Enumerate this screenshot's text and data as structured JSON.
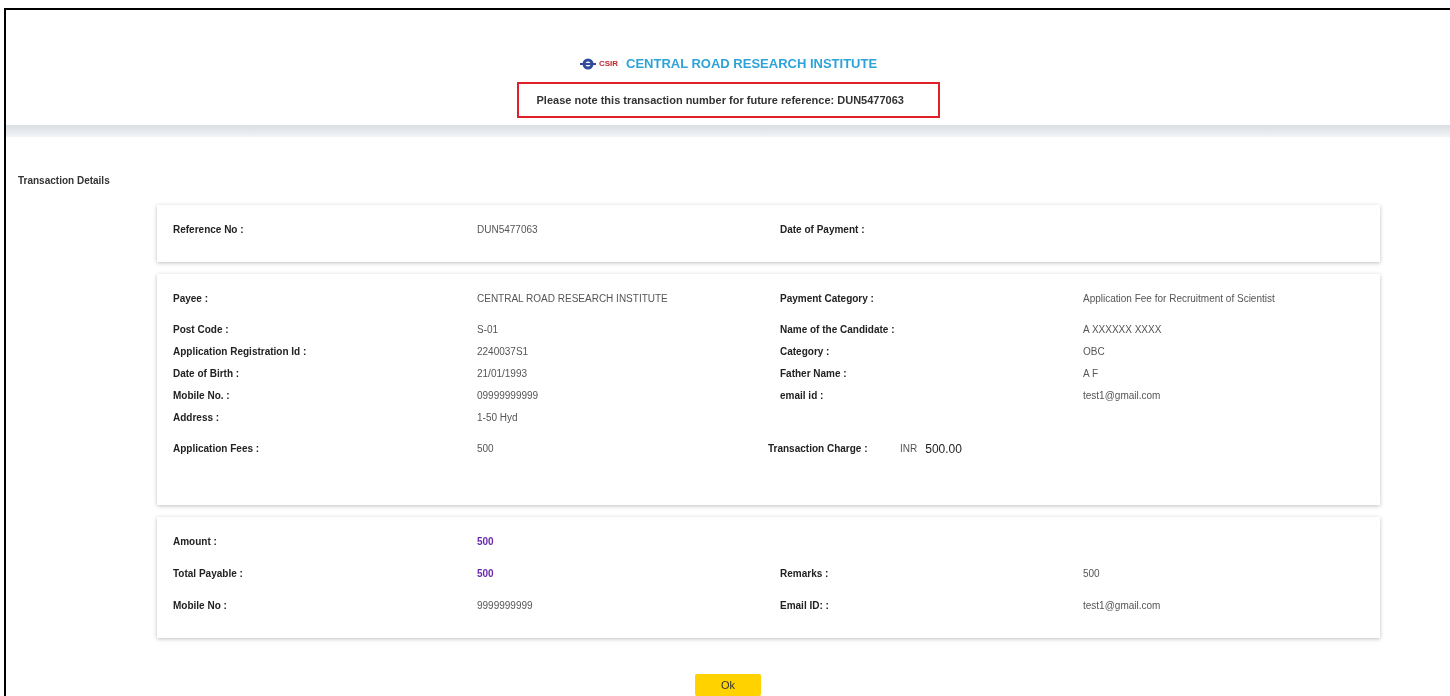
{
  "header": {
    "logo_text": "CSIR",
    "title": "CENTRAL ROAD RESEARCH INSTITUTE",
    "notice": "Please note this transaction number for future reference: DUN5477063"
  },
  "section_title": "Transaction Details",
  "cards": [
    {
      "rows": [
        {
          "left": {
            "label": "Reference No :",
            "value": "DUN5477063"
          },
          "right": {
            "label": "Date of Payment :"
          }
        }
      ]
    },
    {
      "rows": [
        {
          "left": {
            "label": "Payee :",
            "value": "CENTRAL ROAD RESEARCH INSTITUTE"
          },
          "right": {
            "label": "Payment Category :",
            "value": "Application Fee for Recruitment of Scientist"
          }
        },
        {
          "left": {
            "label": "Post Code :",
            "value": "S-01"
          },
          "right": {
            "label": "Name of the Candidate :",
            "value": "A XXXXXX XXXX"
          }
        },
        {
          "left": {
            "label": "Application Registration Id :",
            "value": "2240037S1"
          },
          "right": {
            "label": "Category :",
            "value": "OBC"
          }
        },
        {
          "left": {
            "label": "Date of Birth :",
            "value": "21/01/1993"
          },
          "right": {
            "label": "Father Name :",
            "value": "A F"
          }
        },
        {
          "left": {
            "label": "Mobile No. :",
            "value": "09999999999"
          },
          "right": {
            "label": "email id :",
            "value": "test1@gmail.com"
          }
        },
        {
          "left": {
            "label": "Address :",
            "value": "1-50 Hyd"
          }
        },
        {
          "kind": "charge",
          "left": {
            "label": "Application Fees :",
            "value": "500"
          },
          "right": {
            "label": "Transaction Charge :",
            "currency": "INR",
            "value": "500.00"
          }
        }
      ]
    },
    {
      "rows": [
        {
          "left": {
            "label": "Amount :",
            "value": "500",
            "emphasis": true
          }
        },
        {
          "left": {
            "label": "Total Payable :",
            "value": "500",
            "emphasis": true
          },
          "right": {
            "label": "Remarks :",
            "value": "500"
          }
        },
        {
          "left": {
            "label": "Mobile No :",
            "value": "9999999999"
          },
          "right": {
            "label": "Email ID: :",
            "value": "test1@gmail.com"
          }
        }
      ]
    }
  ],
  "ok_button": "Ok"
}
